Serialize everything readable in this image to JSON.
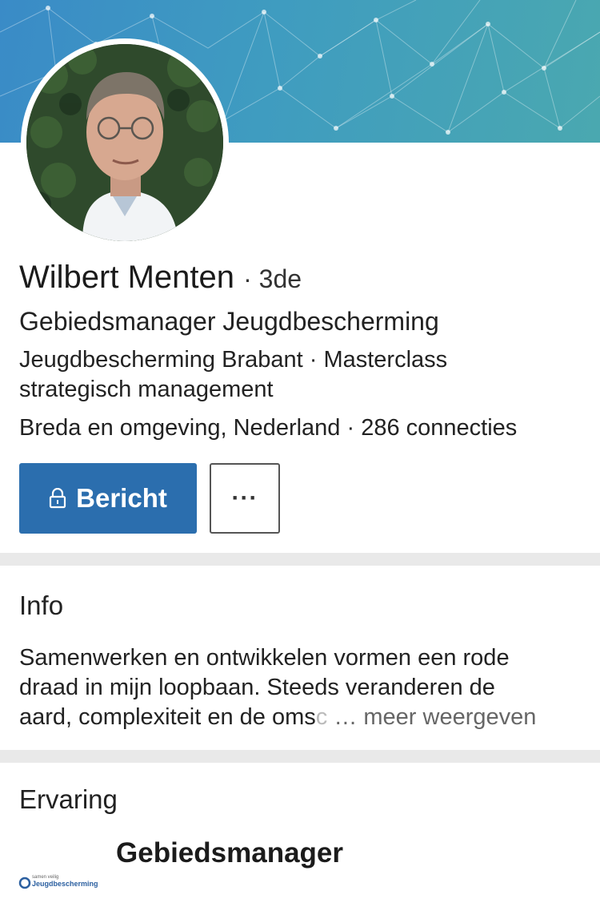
{
  "profile": {
    "name": "Wilbert Menten",
    "degree": "· 3de",
    "headline": "Gebiedsmanager Jeugdbescherming",
    "company_line1": "Jeugdbescherming Brabant · Masterclass",
    "company_line2": "strategisch management",
    "location": "Breda en omgeving, Nederland · 286 connecties"
  },
  "actions": {
    "message_label": "Bericht",
    "message_icon": "lock-icon",
    "more_label": "···"
  },
  "info": {
    "title": "Info",
    "line1": "Samenwerken en ontwikkelen vormen een rode",
    "line2": "draad in mijn loopbaan. Steeds veranderen de",
    "line3": "aard, complexiteit en de oms",
    "line3_faded": "c",
    "more_link": "… meer weergeven"
  },
  "experience": {
    "title": "Ervaring",
    "role": "Gebiedsmanager",
    "logo_text_top": "samen veilig",
    "logo_text": "Jeugdbescherming"
  },
  "colors": {
    "accent": "#2b6eae",
    "banner_start": "#3a8bc7",
    "banner_end": "#4aa8b0"
  }
}
